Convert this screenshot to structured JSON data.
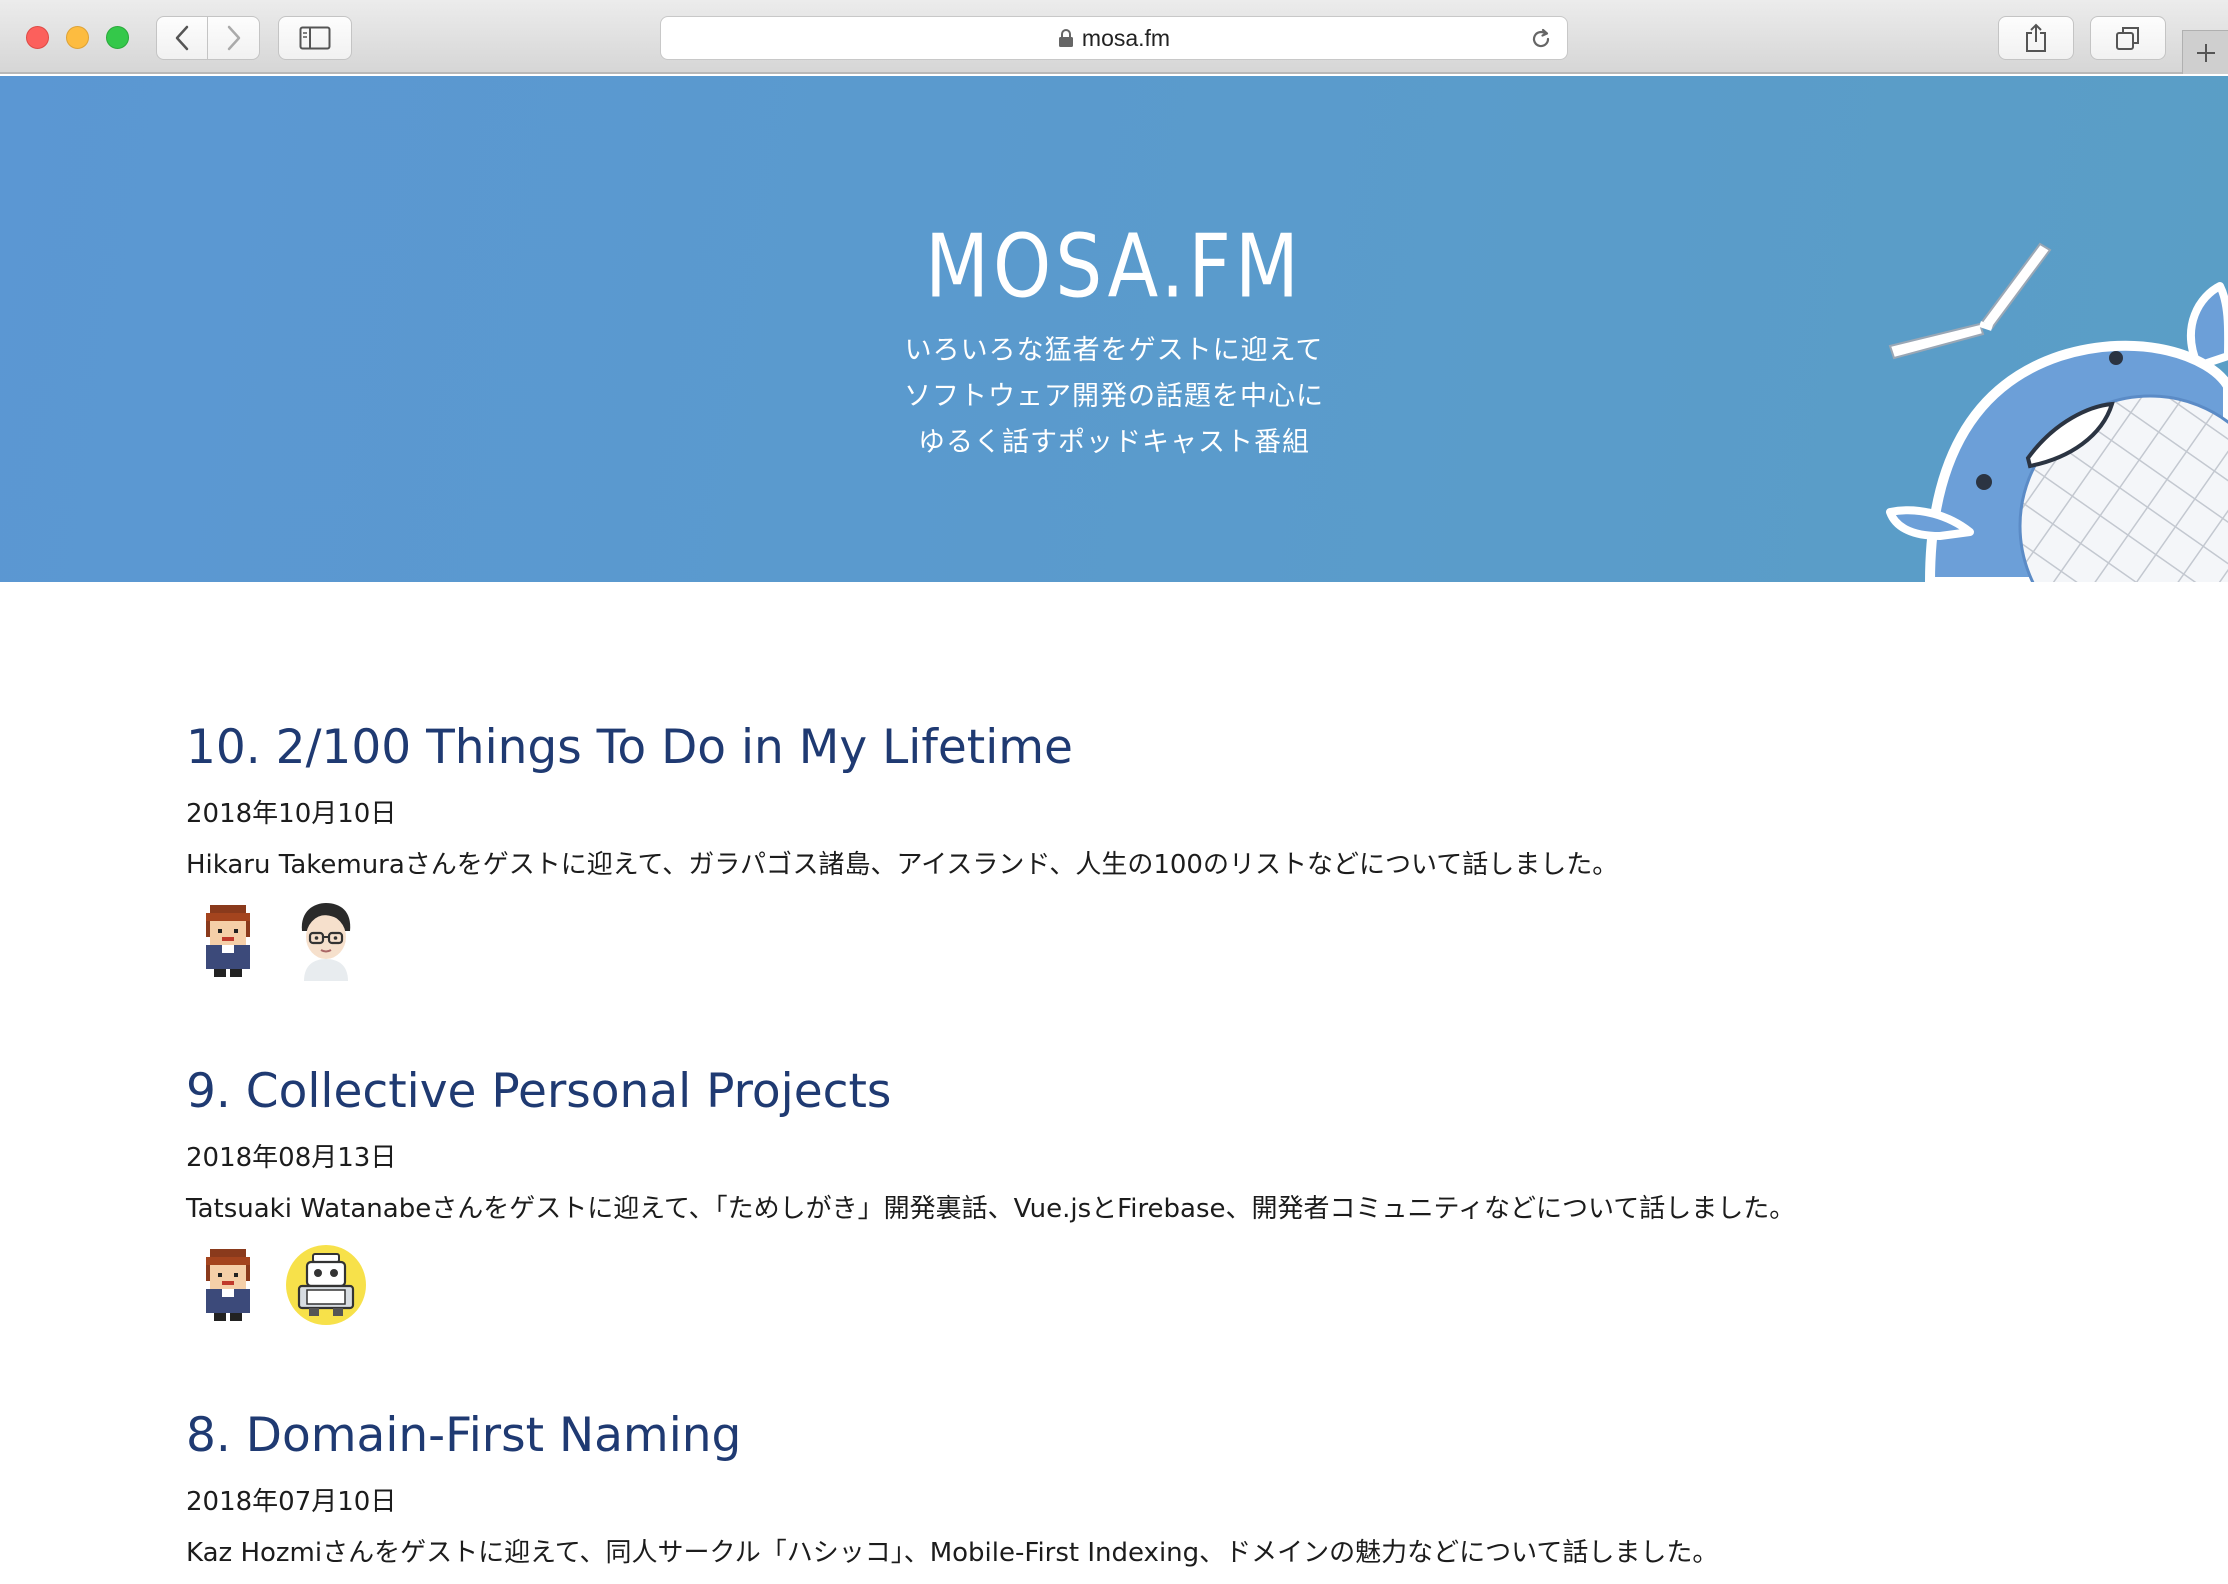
{
  "browser": {
    "url": "mosa.fm",
    "icons": [
      "back-icon",
      "forward-icon",
      "sidebar-icon",
      "lock-icon",
      "reload-icon",
      "share-icon",
      "tabs-icon",
      "new-tab-icon"
    ]
  },
  "hero": {
    "title": "MOSA.FM",
    "tagline": [
      "いろいろな猛者をゲストに迎えて",
      "ソフトウェア開発の話題を中心に",
      "ゆるく話すポッドキャスト番組"
    ]
  },
  "episodes": [
    {
      "title": "10. 2/100 Things To Do in My Lifetime",
      "date": "2018年10月10日",
      "description": "Hikaru Takemuraさんをゲストに迎えて、ガラパゴス諸島、アイスランド、人生の100のリストなどについて話しました。"
    },
    {
      "title": "9. Collective Personal Projects",
      "date": "2018年08月13日",
      "description": "Tatsuaki Watanabeさんをゲストに迎えて、「ためしがき」開発裏話、Vue.jsとFirebase、開発者コミュニティなどについて話しました。"
    },
    {
      "title": "8. Domain-First Naming",
      "date": "2018年07月10日",
      "description": "Kaz Hozmiさんをゲストに迎えて、同人サークル「ハシッコ」、Mobile-First Indexing、ドメインの魅力などについて話しました。"
    }
  ],
  "colors": {
    "hero_bg": "#5a9acd",
    "episode_title": "#1f3a72",
    "text": "#1c1c1c"
  }
}
